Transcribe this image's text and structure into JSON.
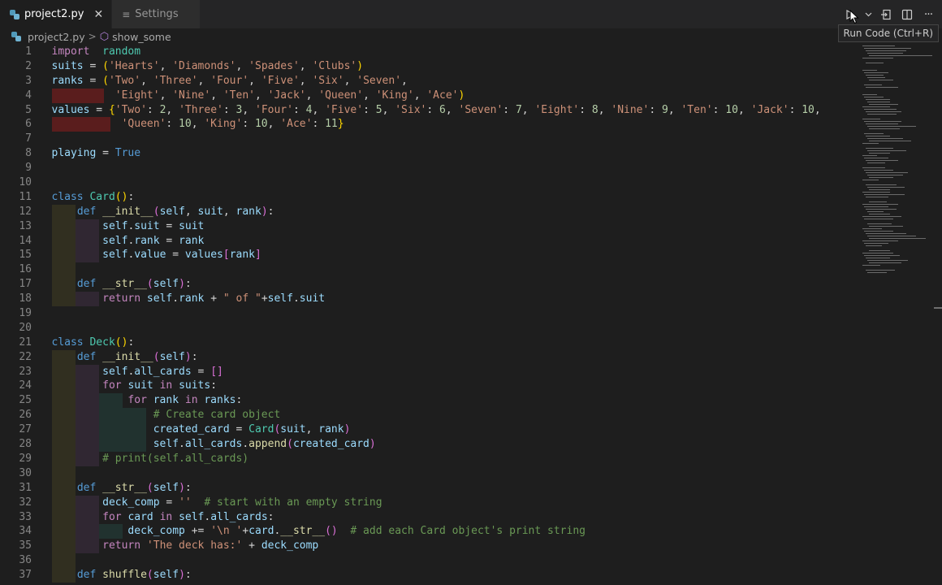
{
  "tabs": [
    {
      "label": "project2.py",
      "active": true,
      "icon": "python-file-icon",
      "close": "✕"
    },
    {
      "label": "Settings",
      "active": false,
      "icon": "settings-icon"
    }
  ],
  "actions": {
    "run_tooltip": "Run Code (Ctrl+R)",
    "more": "···"
  },
  "breadcrumb": {
    "file": "project2.py",
    "separator": ">",
    "symbol": "show_some"
  },
  "colors": {
    "editor_bg": "#1e1e1e",
    "tabbar_bg": "#252526",
    "keyword": "#569cd6",
    "string": "#ce9178",
    "number": "#b5cea8",
    "comment": "#6a9955",
    "error_highlight": "#5a1d1d"
  },
  "lines": [
    {
      "n": "1",
      "t": [
        [
          "kw2",
          "import"
        ],
        [
          "",
          "  "
        ],
        [
          "cls",
          "random"
        ]
      ]
    },
    {
      "n": "2",
      "t": [
        [
          "var",
          "suits"
        ],
        [
          "",
          " = "
        ],
        [
          "br1",
          "("
        ],
        [
          "str",
          "'Hearts'"
        ],
        [
          "",
          ", "
        ],
        [
          "str",
          "'Diamonds'"
        ],
        [
          "",
          ", "
        ],
        [
          "str",
          "'Spades'"
        ],
        [
          "",
          ", "
        ],
        [
          "str",
          "'Clubs'"
        ],
        [
          "br1",
          ")"
        ]
      ]
    },
    {
      "n": "3",
      "t": [
        [
          "var",
          "ranks"
        ],
        [
          "",
          " = "
        ],
        [
          "br1",
          "("
        ],
        [
          "str",
          "'Two'"
        ],
        [
          "",
          ", "
        ],
        [
          "str",
          "'Three'"
        ],
        [
          "",
          ", "
        ],
        [
          "str",
          "'Four'"
        ],
        [
          "",
          ", "
        ],
        [
          "str",
          "'Five'"
        ],
        [
          "",
          ", "
        ],
        [
          "str",
          "'Six'"
        ],
        [
          "",
          ", "
        ],
        [
          "str",
          "'Seven'"
        ],
        [
          "",
          ","
        ]
      ]
    },
    {
      "n": "4",
      "err": 64,
      "t": [
        [
          "",
          "          "
        ],
        [
          "str",
          "'Eight'"
        ],
        [
          "",
          ", "
        ],
        [
          "str",
          "'Nine'"
        ],
        [
          "",
          ", "
        ],
        [
          "str",
          "'Ten'"
        ],
        [
          "",
          ", "
        ],
        [
          "str",
          "'Jack'"
        ],
        [
          "",
          ", "
        ],
        [
          "str",
          "'Queen'"
        ],
        [
          "",
          ", "
        ],
        [
          "str",
          "'King'"
        ],
        [
          "",
          ", "
        ],
        [
          "str",
          "'Ace'"
        ],
        [
          "br1",
          ")"
        ]
      ]
    },
    {
      "n": "5",
      "t": [
        [
          "var",
          "values"
        ],
        [
          "",
          " = "
        ],
        [
          "br1",
          "{"
        ],
        [
          "str",
          "'Two'"
        ],
        [
          "",
          ": "
        ],
        [
          "num",
          "2"
        ],
        [
          "",
          ", "
        ],
        [
          "str",
          "'Three'"
        ],
        [
          "",
          ": "
        ],
        [
          "num",
          "3"
        ],
        [
          "",
          ", "
        ],
        [
          "str",
          "'Four'"
        ],
        [
          "",
          ": "
        ],
        [
          "num",
          "4"
        ],
        [
          "",
          ", "
        ],
        [
          "str",
          "'Five'"
        ],
        [
          "",
          ": "
        ],
        [
          "num",
          "5"
        ],
        [
          "",
          ", "
        ],
        [
          "str",
          "'Six'"
        ],
        [
          "",
          ": "
        ],
        [
          "num",
          "6"
        ],
        [
          "",
          ", "
        ],
        [
          "str",
          "'Seven'"
        ],
        [
          "",
          ": "
        ],
        [
          "num",
          "7"
        ],
        [
          "",
          ", "
        ],
        [
          "str",
          "'Eight'"
        ],
        [
          "",
          ": "
        ],
        [
          "num",
          "8"
        ],
        [
          "",
          ", "
        ],
        [
          "str",
          "'Nine'"
        ],
        [
          "",
          ": "
        ],
        [
          "num",
          "9"
        ],
        [
          "",
          ", "
        ],
        [
          "str",
          "'Ten'"
        ],
        [
          "",
          ": "
        ],
        [
          "num",
          "10"
        ],
        [
          "",
          ", "
        ],
        [
          "str",
          "'Jack'"
        ],
        [
          "",
          ": "
        ],
        [
          "num",
          "10"
        ],
        [
          "",
          ","
        ]
      ]
    },
    {
      "n": "6",
      "err": 72,
      "t": [
        [
          "",
          "           "
        ],
        [
          "str",
          "'Queen'"
        ],
        [
          "",
          ": "
        ],
        [
          "num",
          "10"
        ],
        [
          "",
          ", "
        ],
        [
          "str",
          "'King'"
        ],
        [
          "",
          ": "
        ],
        [
          "num",
          "10"
        ],
        [
          "",
          ", "
        ],
        [
          "str",
          "'Ace'"
        ],
        [
          "",
          ": "
        ],
        [
          "num",
          "11"
        ],
        [
          "br1",
          "}"
        ]
      ]
    },
    {
      "n": "7",
      "t": []
    },
    {
      "n": "8",
      "t": [
        [
          "var",
          "playing"
        ],
        [
          "",
          " = "
        ],
        [
          "kw",
          "True"
        ]
      ]
    },
    {
      "n": "9",
      "t": []
    },
    {
      "n": "10",
      "t": []
    },
    {
      "n": "11",
      "t": [
        [
          "kw",
          "class"
        ],
        [
          "",
          " "
        ],
        [
          "cls",
          "Card"
        ],
        [
          "br1",
          "()"
        ],
        [
          "",
          ":"
        ]
      ]
    },
    {
      "n": "12",
      "g": 1,
      "t": [
        [
          "",
          "    "
        ],
        [
          "kw",
          "def"
        ],
        [
          "",
          " "
        ],
        [
          "fn",
          "__init__"
        ],
        [
          "br2",
          "("
        ],
        [
          "var",
          "self"
        ],
        [
          "",
          ", "
        ],
        [
          "var",
          "suit"
        ],
        [
          "",
          ", "
        ],
        [
          "var",
          "rank"
        ],
        [
          "br2",
          ")"
        ],
        [
          "",
          ":"
        ]
      ]
    },
    {
      "n": "13",
      "g": 2,
      "t": [
        [
          "",
          "        "
        ],
        [
          "var",
          "self"
        ],
        [
          "",
          "."
        ],
        [
          "var",
          "suit"
        ],
        [
          "",
          " = "
        ],
        [
          "var",
          "suit"
        ]
      ]
    },
    {
      "n": "14",
      "g": 2,
      "t": [
        [
          "",
          "        "
        ],
        [
          "var",
          "self"
        ],
        [
          "",
          "."
        ],
        [
          "var",
          "rank"
        ],
        [
          "",
          " = "
        ],
        [
          "var",
          "rank"
        ]
      ]
    },
    {
      "n": "15",
      "g": 2,
      "t": [
        [
          "",
          "        "
        ],
        [
          "var",
          "self"
        ],
        [
          "",
          "."
        ],
        [
          "var",
          "value"
        ],
        [
          "",
          " = "
        ],
        [
          "var",
          "values"
        ],
        [
          "br2",
          "["
        ],
        [
          "var",
          "rank"
        ],
        [
          "br2",
          "]"
        ]
      ]
    },
    {
      "n": "16",
      "g": 1,
      "t": []
    },
    {
      "n": "17",
      "g": 1,
      "t": [
        [
          "",
          "    "
        ],
        [
          "kw",
          "def"
        ],
        [
          "",
          " "
        ],
        [
          "fn",
          "__str__"
        ],
        [
          "br2",
          "("
        ],
        [
          "var",
          "self"
        ],
        [
          "br2",
          ")"
        ],
        [
          "",
          ":"
        ]
      ]
    },
    {
      "n": "18",
      "g": 2,
      "t": [
        [
          "",
          "        "
        ],
        [
          "kw2",
          "return"
        ],
        [
          "",
          " "
        ],
        [
          "var",
          "self"
        ],
        [
          "",
          "."
        ],
        [
          "var",
          "rank"
        ],
        [
          "",
          " + "
        ],
        [
          "str",
          "\" of \""
        ],
        [
          "",
          "+"
        ],
        [
          "var",
          "self"
        ],
        [
          "",
          "."
        ],
        [
          "var",
          "suit"
        ]
      ]
    },
    {
      "n": "19",
      "t": []
    },
    {
      "n": "20",
      "t": []
    },
    {
      "n": "21",
      "t": [
        [
          "kw",
          "class"
        ],
        [
          "",
          " "
        ],
        [
          "cls",
          "Deck"
        ],
        [
          "br1",
          "()"
        ],
        [
          "",
          ":"
        ]
      ]
    },
    {
      "n": "22",
      "g": 1,
      "t": [
        [
          "",
          "    "
        ],
        [
          "kw",
          "def"
        ],
        [
          "",
          " "
        ],
        [
          "fn",
          "__init__"
        ],
        [
          "br2",
          "("
        ],
        [
          "var",
          "self"
        ],
        [
          "br2",
          ")"
        ],
        [
          "",
          ":"
        ]
      ]
    },
    {
      "n": "23",
      "g": 2,
      "t": [
        [
          "",
          "        "
        ],
        [
          "var",
          "self"
        ],
        [
          "",
          "."
        ],
        [
          "var",
          "all_cards"
        ],
        [
          "",
          " = "
        ],
        [
          "br2",
          "[]"
        ]
      ]
    },
    {
      "n": "24",
      "g": 2,
      "t": [
        [
          "",
          "        "
        ],
        [
          "kw2",
          "for"
        ],
        [
          "",
          " "
        ],
        [
          "var",
          "suit"
        ],
        [
          "",
          " "
        ],
        [
          "kw2",
          "in"
        ],
        [
          "",
          " "
        ],
        [
          "var",
          "suits"
        ],
        [
          "",
          ":"
        ]
      ]
    },
    {
      "n": "25",
      "g": 3,
      "t": [
        [
          "",
          "            "
        ],
        [
          "kw2",
          "for"
        ],
        [
          "",
          " "
        ],
        [
          "var",
          "rank"
        ],
        [
          "",
          " "
        ],
        [
          "kw2",
          "in"
        ],
        [
          "",
          " "
        ],
        [
          "var",
          "ranks"
        ],
        [
          "",
          ":"
        ]
      ]
    },
    {
      "n": "26",
      "g": 4,
      "t": [
        [
          "",
          "                "
        ],
        [
          "cmt",
          "# Create card object"
        ]
      ]
    },
    {
      "n": "27",
      "g": 4,
      "t": [
        [
          "",
          "                "
        ],
        [
          "var",
          "created_card"
        ],
        [
          "",
          " = "
        ],
        [
          "cls",
          "Card"
        ],
        [
          "br2",
          "("
        ],
        [
          "var",
          "suit"
        ],
        [
          "",
          ", "
        ],
        [
          "var",
          "rank"
        ],
        [
          "br2",
          ")"
        ]
      ]
    },
    {
      "n": "28",
      "g": 4,
      "t": [
        [
          "",
          "                "
        ],
        [
          "var",
          "self"
        ],
        [
          "",
          "."
        ],
        [
          "var",
          "all_cards"
        ],
        [
          "",
          "."
        ],
        [
          "fn",
          "append"
        ],
        [
          "br2",
          "("
        ],
        [
          "var",
          "created_card"
        ],
        [
          "br2",
          ")"
        ]
      ]
    },
    {
      "n": "29",
      "g": 2,
      "t": [
        [
          "",
          "        "
        ],
        [
          "cmt",
          "# print(self.all_cards)"
        ]
      ]
    },
    {
      "n": "30",
      "g": 1,
      "t": []
    },
    {
      "n": "31",
      "g": 1,
      "t": [
        [
          "",
          "    "
        ],
        [
          "kw",
          "def"
        ],
        [
          "",
          " "
        ],
        [
          "fn",
          "__str__"
        ],
        [
          "br2",
          "("
        ],
        [
          "var",
          "self"
        ],
        [
          "br2",
          ")"
        ],
        [
          "",
          ":"
        ]
      ]
    },
    {
      "n": "32",
      "g": 2,
      "t": [
        [
          "",
          "        "
        ],
        [
          "var",
          "deck_comp"
        ],
        [
          "",
          " = "
        ],
        [
          "str",
          "''"
        ],
        [
          "",
          "  "
        ],
        [
          "cmt",
          "# start with an empty string"
        ]
      ]
    },
    {
      "n": "33",
      "g": 2,
      "t": [
        [
          "",
          "        "
        ],
        [
          "kw2",
          "for"
        ],
        [
          "",
          " "
        ],
        [
          "var",
          "card"
        ],
        [
          "",
          " "
        ],
        [
          "kw2",
          "in"
        ],
        [
          "",
          " "
        ],
        [
          "var",
          "self"
        ],
        [
          "",
          "."
        ],
        [
          "var",
          "all_cards"
        ],
        [
          "",
          ":"
        ]
      ]
    },
    {
      "n": "34",
      "g": 3,
      "t": [
        [
          "",
          "            "
        ],
        [
          "var",
          "deck_comp"
        ],
        [
          "",
          " += "
        ],
        [
          "str",
          "'\\n '"
        ],
        [
          "",
          "+"
        ],
        [
          "var",
          "card"
        ],
        [
          "",
          "."
        ],
        [
          "fn",
          "__str__"
        ],
        [
          "br2",
          "()"
        ],
        [
          "",
          "  "
        ],
        [
          "cmt",
          "# add each Card object's print string"
        ]
      ]
    },
    {
      "n": "35",
      "g": 2,
      "t": [
        [
          "",
          "        "
        ],
        [
          "kw2",
          "return"
        ],
        [
          "",
          " "
        ],
        [
          "str",
          "'The deck has:'"
        ],
        [
          "",
          " + "
        ],
        [
          "var",
          "deck_comp"
        ]
      ]
    },
    {
      "n": "36",
      "g": 1,
      "t": []
    },
    {
      "n": "37",
      "g": 1,
      "t": [
        [
          "",
          "    "
        ],
        [
          "kw",
          "def"
        ],
        [
          "",
          " "
        ],
        [
          "fn",
          "shuffle"
        ],
        [
          "br2",
          "("
        ],
        [
          "var",
          "self"
        ],
        [
          "br2",
          ")"
        ],
        [
          "",
          ":"
        ]
      ]
    }
  ]
}
